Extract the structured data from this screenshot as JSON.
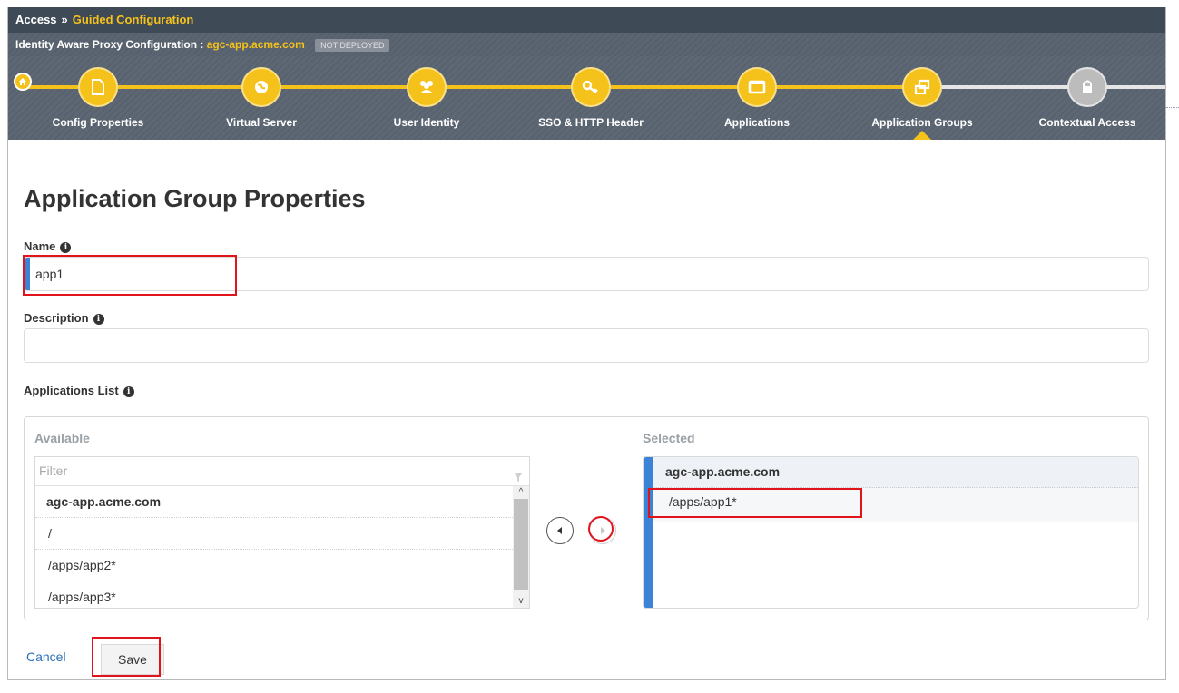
{
  "breadcrumb": {
    "root": "Access",
    "separator": "»",
    "current": "Guided Configuration"
  },
  "subheader": {
    "title_prefix": "Identity Aware Proxy Configuration : ",
    "config_name": "agc-app.acme.com",
    "status_badge": "NOT DEPLOYED"
  },
  "wizard": {
    "steps": [
      {
        "label": "Config Properties",
        "icon": "document-icon",
        "state": "done"
      },
      {
        "label": "Virtual Server",
        "icon": "globe-icon",
        "state": "done"
      },
      {
        "label": "User Identity",
        "icon": "users-icon",
        "state": "done"
      },
      {
        "label": "SSO & HTTP Header",
        "icon": "key-icon",
        "state": "done"
      },
      {
        "label": "Applications",
        "icon": "window-icon",
        "state": "done"
      },
      {
        "label": "Application Groups",
        "icon": "group-icon",
        "state": "current"
      },
      {
        "label": "Contextual Access",
        "icon": "lock-icon",
        "state": "disabled"
      }
    ],
    "accent_color": "#f5c21b"
  },
  "page": {
    "title": "Application Group Properties"
  },
  "form": {
    "name_label": "Name",
    "name_value": "app1",
    "description_label": "Description",
    "description_value": "",
    "apps_list_label": "Applications List"
  },
  "apps": {
    "available_title": "Available",
    "filter_placeholder": "Filter",
    "available_group": "agc-app.acme.com",
    "available_items": [
      "/",
      "/apps/app2*",
      "/apps/app3*"
    ],
    "selected_title": "Selected",
    "selected_group": "agc-app.acme.com",
    "selected_items": [
      "/apps/app1*"
    ]
  },
  "actions": {
    "cancel_label": "Cancel",
    "save_label": "Save"
  },
  "colors": {
    "highlight": "#e1141b",
    "link": "#2a6fb8",
    "input_accent": "#3b83d6"
  }
}
